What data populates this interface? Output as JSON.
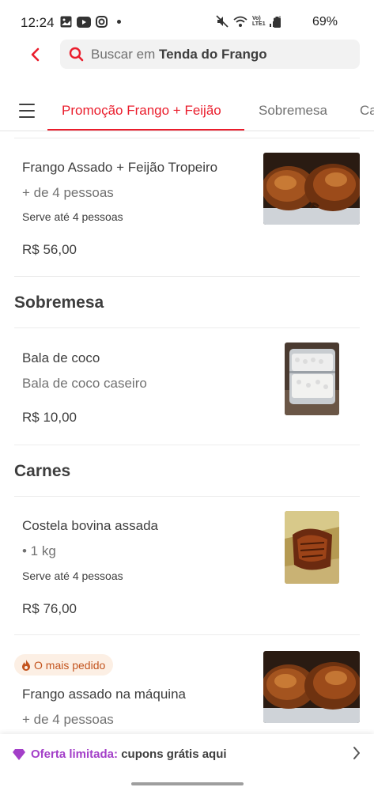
{
  "status_bar": {
    "time": "12:24",
    "battery": "69%",
    "network_label": "Vo) LTE1"
  },
  "header": {
    "search_prefix": "Buscar em ",
    "search_store": "Tenda do Frango"
  },
  "tabs": [
    {
      "label": "Promoção Frango + Feijão",
      "active": true
    },
    {
      "label": "Sobremesa",
      "active": false
    },
    {
      "label": "Ca",
      "active": false
    }
  ],
  "items": {
    "frango_tropeiro": {
      "title": "Frango Assado + Feijão Tropeiro",
      "desc": "+ de 4 pessoas",
      "serves": "Serve até 4 pessoas",
      "price": "R$ 56,00"
    },
    "bala_coco": {
      "title": "Bala de coco",
      "desc": "Bala de coco caseiro",
      "price": "R$ 10,00"
    },
    "costela": {
      "title": "Costela bovina assada",
      "desc": "• 1 kg",
      "serves": "Serve até 4 pessoas",
      "price": "R$ 76,00"
    },
    "frango_maquina": {
      "badge": "O mais pedido",
      "title": "Frango assado na máquina",
      "desc": "+ de 4 pessoas"
    }
  },
  "sections": {
    "sobremesa": "Sobremesa",
    "carnes": "Carnes"
  },
  "banner": {
    "accent": "Oferta limitada:",
    "text": " cupons grátis aqui"
  },
  "colors": {
    "brand_red": "#ea1d2c",
    "banner_purple": "#a33fc8",
    "badge_bg": "#fcefe4",
    "badge_text": "#c3541e"
  }
}
